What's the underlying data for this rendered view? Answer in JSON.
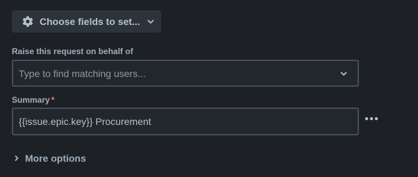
{
  "choose_fields": {
    "label": "Choose fields to set...",
    "icon": "gear-icon"
  },
  "on_behalf": {
    "label": "Raise this request on behalf of",
    "placeholder": "Type to find matching users..."
  },
  "summary": {
    "label": "Summary",
    "required_marker": "*",
    "value": "{{issue.epic.key}} Procurement"
  },
  "more_options": {
    "label": "More options"
  },
  "colors": {
    "background": "#1d2125",
    "button_bg": "#2c333a",
    "input_border": "#454f59",
    "required": "#f87168"
  }
}
